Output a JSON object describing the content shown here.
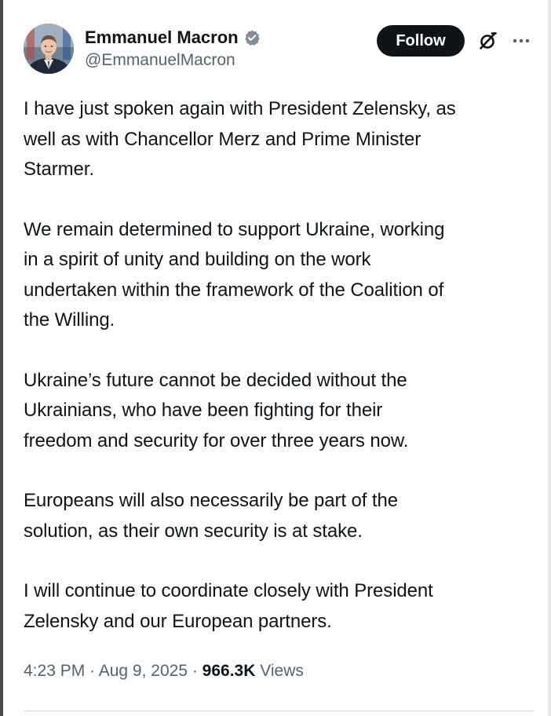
{
  "author": {
    "display_name": "Emmanuel Macron",
    "handle": "@EmmanuelMacron",
    "verified": true
  },
  "actions": {
    "follow_label": "Follow"
  },
  "icons": {
    "verified": "verified-badge-icon",
    "grok": "grok-icon",
    "more": "more-horizontal-icon"
  },
  "colors": {
    "text": "#0f1419",
    "secondary": "#536471",
    "follow_bg": "#0f1419",
    "verified": "#7f8c9a"
  },
  "tweet": {
    "paragraphs": [
      "I have just spoken again with President Zelensky, as\nwell as with Chancellor Merz and Prime Minister\nStarmer.",
      "We remain determined to support Ukraine, working\nin a spirit of unity and building on the work\nundertaken within the framework of the Coalition of\nthe Willing.",
      "Ukraine’s future cannot be decided without the\nUkrainians, who have been fighting for their\nfreedom and security for over three years now.",
      "Europeans will also necessarily be part of the\nsolution, as their own security is at stake.",
      "I will continue to coordinate closely with President\nZelensky and our European partners."
    ],
    "time": "4:23 PM",
    "separator": " · ",
    "date": "Aug 9, 2025",
    "views_count": "966.3K",
    "views_label": " Views"
  }
}
